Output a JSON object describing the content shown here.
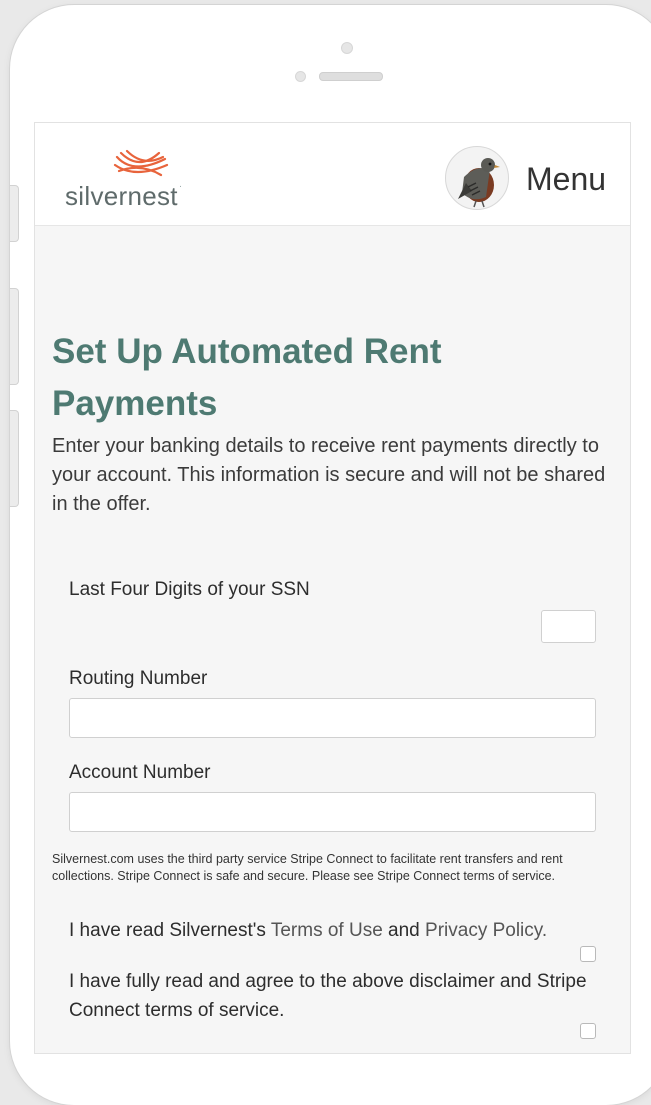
{
  "header": {
    "logo_text": "silvernest",
    "logo_tm": "·",
    "menu_label": "Menu"
  },
  "page": {
    "title": "Set Up Automated Rent Payments",
    "description": "Enter your banking details to receive rent payments directly to your account. This information is secure and will not be shared in the offer."
  },
  "form": {
    "ssn_label": "Last Four Digits of your SSN",
    "ssn_value": "",
    "routing_label": "Routing Number",
    "routing_value": "",
    "account_label": "Account Number",
    "account_value": ""
  },
  "disclaimer": "Silvernest.com uses the third party service Stripe Connect to facilitate rent transfers and rent collections. Stripe Connect is safe and secure. Please see Stripe Connect terms of service.",
  "agreements": {
    "terms_prefix": "I have read Silvernest's",
    "terms_link": "Terms of Use",
    "terms_and": "and",
    "privacy_link": "Privacy Policy.",
    "disclaimer_agree": "I have fully read and agree to the above disclaimer and Stripe Connect terms of service."
  },
  "colors": {
    "accent": "#4e7a72",
    "logo_orange": "#e8643c"
  }
}
